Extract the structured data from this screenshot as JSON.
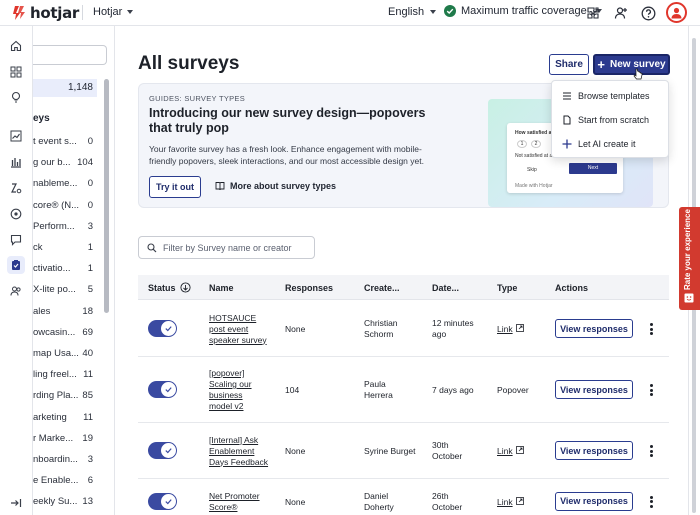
{
  "brand": {
    "name": "hotjar",
    "accent": "#e0362c"
  },
  "topbar": {
    "org": "Hotjar",
    "language": "English",
    "coverage": "Maximum traffic coverage"
  },
  "sidebar": {
    "all_count": "1,148",
    "section_label": "eys",
    "items": [
      {
        "name": "t event s...",
        "count": "0"
      },
      {
        "name": "g our b...",
        "count": "104"
      },
      {
        "name": "nableme...",
        "count": "0"
      },
      {
        "name": "core® (N...",
        "count": "0"
      },
      {
        "name": "Perform...",
        "count": "3"
      },
      {
        "name": "ck",
        "count": "1"
      },
      {
        "name": "ctivatio...",
        "count": "1"
      },
      {
        "name": "X-lite po...",
        "count": "5"
      },
      {
        "name": "ales",
        "count": "18"
      },
      {
        "name": "owcasin...",
        "count": "69"
      },
      {
        "name": "map Usa...",
        "count": "40"
      },
      {
        "name": "ling freel...",
        "count": "11"
      },
      {
        "name": "rding Pla...",
        "count": "85"
      },
      {
        "name": "arketing",
        "count": "11"
      },
      {
        "name": "r Marke...",
        "count": "19"
      },
      {
        "name": "nboardin...",
        "count": "3"
      },
      {
        "name": "e Enable...",
        "count": "6"
      },
      {
        "name": "eekly Su...",
        "count": "13"
      }
    ]
  },
  "main": {
    "title": "All surveys",
    "share_label": "Share",
    "new_survey_label": "New survey",
    "banner": {
      "eyebrow": "GUIDES: SURVEY TYPES",
      "title": "Introducing our new survey design—popovers that truly pop",
      "text": "Your favorite survey has a fresh look. Enhance engagement with mobile-friendly popovers, sleek interactions, and our most accessible design yet.",
      "try_label": "Try it out",
      "more_label": "More about survey types",
      "preview": {
        "question": "How satisfied a",
        "scale_1": "1",
        "scale_2": "2",
        "scale_low": "Not satisfied at a",
        "skip": "Skip",
        "next": "Next",
        "footer": "Made with Hotjar"
      }
    },
    "dropdown": [
      {
        "label": "Browse templates",
        "icon": "list-icon"
      },
      {
        "label": "Start from scratch",
        "icon": "document-icon"
      },
      {
        "label": "Let AI create it",
        "icon": "sparkle-icon"
      }
    ],
    "filter_placeholder": "Filter by Survey name or creator",
    "table": {
      "headers": {
        "status": "Status",
        "name": "Name",
        "responses": "Responses",
        "creator": "Create...",
        "date": "Date...",
        "type": "Type",
        "actions": "Actions"
      },
      "rows": [
        {
          "name_lines": [
            "HOTSAUCE",
            "post event",
            "speaker survey"
          ],
          "responses": "None",
          "creator_lines": [
            "Christian",
            "Schorm"
          ],
          "date_lines": [
            "12 minutes",
            "ago"
          ],
          "type": "Link",
          "action": "View responses"
        },
        {
          "name_lines": [
            "[popover]",
            "Scaling our",
            "business",
            "model v2"
          ],
          "responses": "104",
          "creator_lines": [
            "Paula",
            "Herrera"
          ],
          "date_lines": [
            "7 days ago"
          ],
          "type": "Popover",
          "action": "View responses"
        },
        {
          "name_lines": [
            "[Internal] Ask",
            "Enablement",
            "Days Feedback"
          ],
          "responses": "None",
          "creator_lines": [
            "Syrine Burget"
          ],
          "date_lines": [
            "30th",
            "October"
          ],
          "type": "Link",
          "action": "View responses"
        },
        {
          "name_lines": [
            "Net Promoter",
            "Score® (NPS®)"
          ],
          "responses": "None",
          "creator_lines": [
            "Daniel",
            "Doherty"
          ],
          "date_lines": [
            "26th",
            "October"
          ],
          "type": "Link",
          "action": "View responses"
        }
      ]
    }
  },
  "feedback_tab": {
    "label": "Rate your experience",
    "color": "#d23a2f"
  }
}
